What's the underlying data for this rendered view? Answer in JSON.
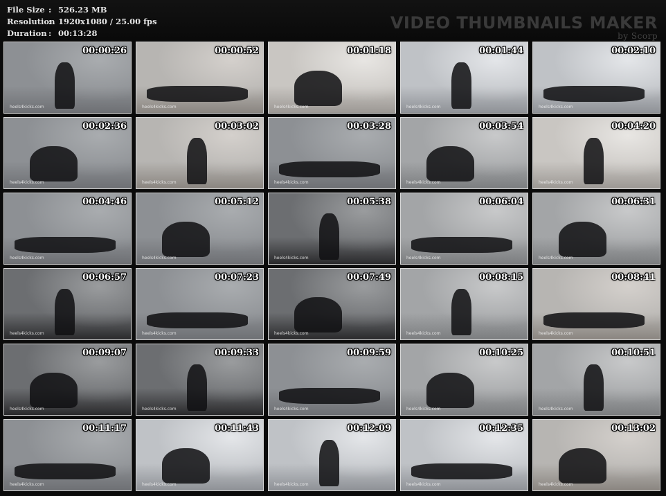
{
  "header": {
    "file_size_label": "File Size",
    "file_size_value": "526.23 MB",
    "resolution_label": "Resolution",
    "resolution_value": "1920x1080 / 25.00 fps",
    "duration_label": "Duration",
    "duration_value": "00:13:28",
    "separator": ":",
    "brand_title": "VIDEO THUMBNAILS MAKER",
    "brand_by": "by Scorp"
  },
  "thumbnails": [
    {
      "time": "00:00:26",
      "watermark": "heels4kicks.com",
      "scene": "concrete-wall"
    },
    {
      "time": "00:00:52",
      "watermark": "heels4kicks.com",
      "scene": "closeup-wall"
    },
    {
      "time": "00:01:18",
      "watermark": "heels4kicks.com",
      "scene": "closeup-light"
    },
    {
      "time": "00:01:44",
      "watermark": "heels4kicks.com",
      "scene": "room-light"
    },
    {
      "time": "00:02:10",
      "watermark": "heels4kicks.com",
      "scene": "room-light"
    },
    {
      "time": "00:02:36",
      "watermark": "heels4kicks.com",
      "scene": "concrete-wall"
    },
    {
      "time": "00:03:02",
      "watermark": "heels4kicks.com",
      "scene": "closeup-wall"
    },
    {
      "time": "00:03:28",
      "watermark": "heels4kicks.com",
      "scene": "concrete-wall"
    },
    {
      "time": "00:03:54",
      "watermark": "heels4kicks.com",
      "scene": "floor"
    },
    {
      "time": "00:04:20",
      "watermark": "heels4kicks.com",
      "scene": "closeup-light"
    },
    {
      "time": "00:04:46",
      "watermark": "heels4kicks.com",
      "scene": "concrete-wall"
    },
    {
      "time": "00:05:12",
      "watermark": "heels4kicks.com",
      "scene": "concrete-wall"
    },
    {
      "time": "00:05:38",
      "watermark": "heels4kicks.com",
      "scene": "floor-dark"
    },
    {
      "time": "00:06:04",
      "watermark": "heels4kicks.com",
      "scene": "floor"
    },
    {
      "time": "00:06:31",
      "watermark": "heels4kicks.com",
      "scene": "floor"
    },
    {
      "time": "00:06:57",
      "watermark": "heels4kicks.com",
      "scene": "floor-dark"
    },
    {
      "time": "00:07:23",
      "watermark": "heels4kicks.com",
      "scene": "concrete-wall"
    },
    {
      "time": "00:07:49",
      "watermark": "heels4kicks.com",
      "scene": "floor-dark"
    },
    {
      "time": "00:08:15",
      "watermark": "heels4kicks.com",
      "scene": "floor"
    },
    {
      "time": "00:08:41",
      "watermark": "heels4kicks.com",
      "scene": "closeup-wall"
    },
    {
      "time": "00:09:07",
      "watermark": "heels4kicks.com",
      "scene": "floor-dark"
    },
    {
      "time": "00:09:33",
      "watermark": "heels4kicks.com",
      "scene": "floor-dark"
    },
    {
      "time": "00:09:59",
      "watermark": "heels4kicks.com",
      "scene": "concrete-wall"
    },
    {
      "time": "00:10:25",
      "watermark": "heels4kicks.com",
      "scene": "floor"
    },
    {
      "time": "00:10:51",
      "watermark": "heels4kicks.com",
      "scene": "floor"
    },
    {
      "time": "00:11:17",
      "watermark": "heels4kicks.com",
      "scene": "concrete-wall"
    },
    {
      "time": "00:11:43",
      "watermark": "heels4kicks.com",
      "scene": "room-light"
    },
    {
      "time": "00:12:09",
      "watermark": "heels4kicks.com",
      "scene": "room-light"
    },
    {
      "time": "00:12:35",
      "watermark": "heels4kicks.com",
      "scene": "room-light"
    },
    {
      "time": "00:13:02",
      "watermark": "heels4kicks.com",
      "scene": "closeup-wall"
    }
  ]
}
